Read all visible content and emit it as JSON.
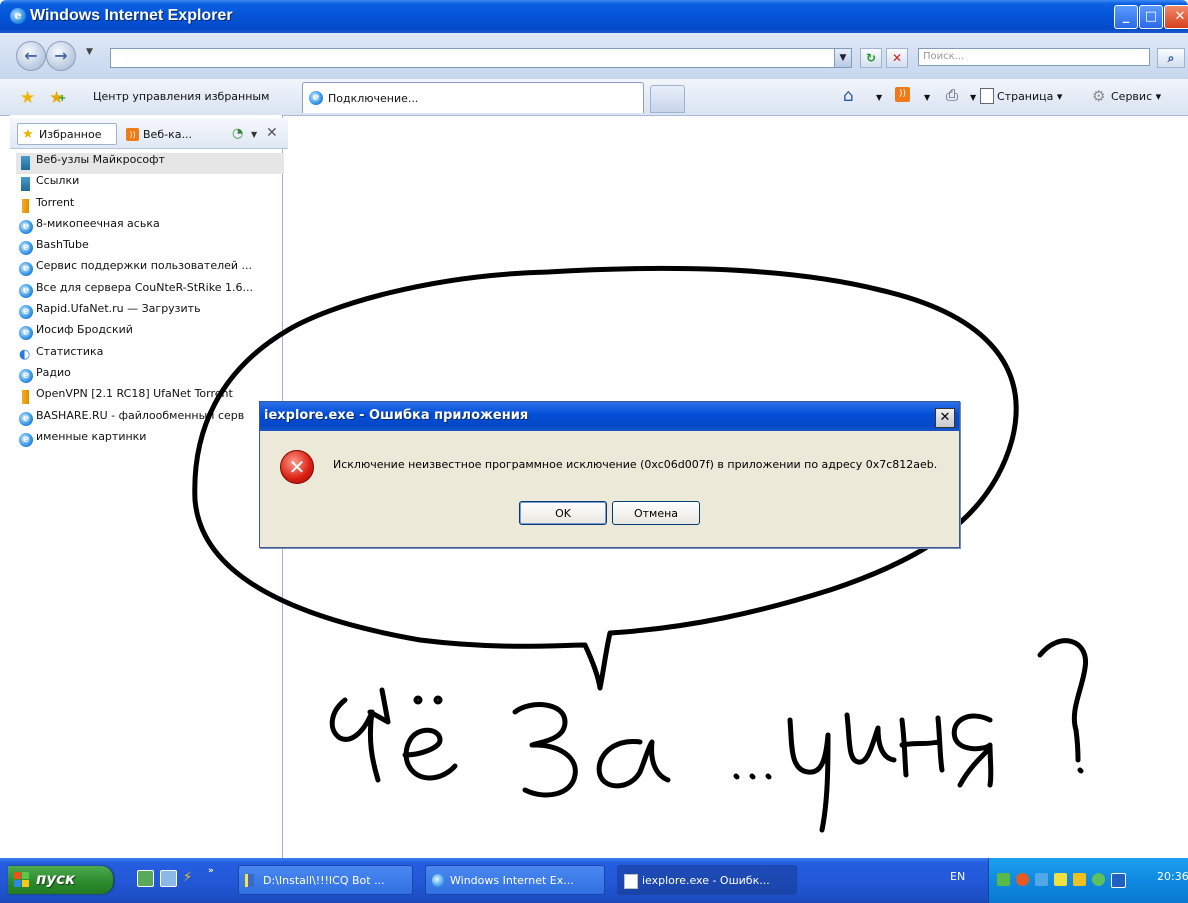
{
  "window": {
    "title": "Windows Internet Explorer"
  },
  "navbar": {
    "address_value": "",
    "search_placeholder": "Поиск..."
  },
  "cmdbar": {
    "favorites_center": "Центр управления избранным",
    "tab_label": "Подключение...",
    "page_menu": "Страница",
    "service_menu": "Сервис"
  },
  "favorites_panel": {
    "tab_favorites": "Избранное",
    "tab_feeds": "Веб-ка...",
    "items": [
      {
        "label": "Веб-узлы Майкрософт",
        "icon": "folder-icon"
      },
      {
        "label": "Ссылки",
        "icon": "folder-icon"
      },
      {
        "label": "Torrent",
        "icon": "folder-icon"
      },
      {
        "label": "8-микопеечная аська",
        "icon": "ie-page-icon"
      },
      {
        "label": "BashTube",
        "icon": "ie-page-icon"
      },
      {
        "label": "Сервис поддержки пользователей ...",
        "icon": "ie-page-icon"
      },
      {
        "label": "Все для сервера CouNteR-StRike 1.6...",
        "icon": "ie-page-icon"
      },
      {
        "label": "Rapid.UfaNet.ru — Загрузить",
        "icon": "ie-page-icon"
      },
      {
        "label": "Иосиф Бродский",
        "icon": "ie-page-icon"
      },
      {
        "label": "Статистика",
        "icon": "statistics-icon"
      },
      {
        "label": "Радио",
        "icon": "ie-page-icon"
      },
      {
        "label": "OpenVPN [2.1 RC18]  UfaNet Torrent",
        "icon": "folder-icon"
      },
      {
        "label": "BASHARE.RU - файлообменный серв",
        "icon": "ie-page-icon"
      },
      {
        "label": "именные картинки",
        "icon": "ie-page-icon"
      }
    ]
  },
  "dialog": {
    "title": "iexplore.exe - Ошибка приложения",
    "message": "Исключение неизвестное программное исключение (0xc06d007f) в приложении по адресу 0x7c812aeb.",
    "ok_label": "OK",
    "cancel_label": "Отмена"
  },
  "taskbar": {
    "start_label": "пуск",
    "tasks": [
      "D:\\Install\\!!!ICQ Bot ...",
      "Windows Internet Ex...",
      "iexplore.exe - Ошибк..."
    ],
    "language": "EN",
    "clock": "20:36"
  },
  "colors": {
    "titlebar_blue": "#0453d8",
    "dialog_face": "#ece9d8",
    "start_green": "#2a8a2a",
    "scribble_black": "#000000"
  }
}
